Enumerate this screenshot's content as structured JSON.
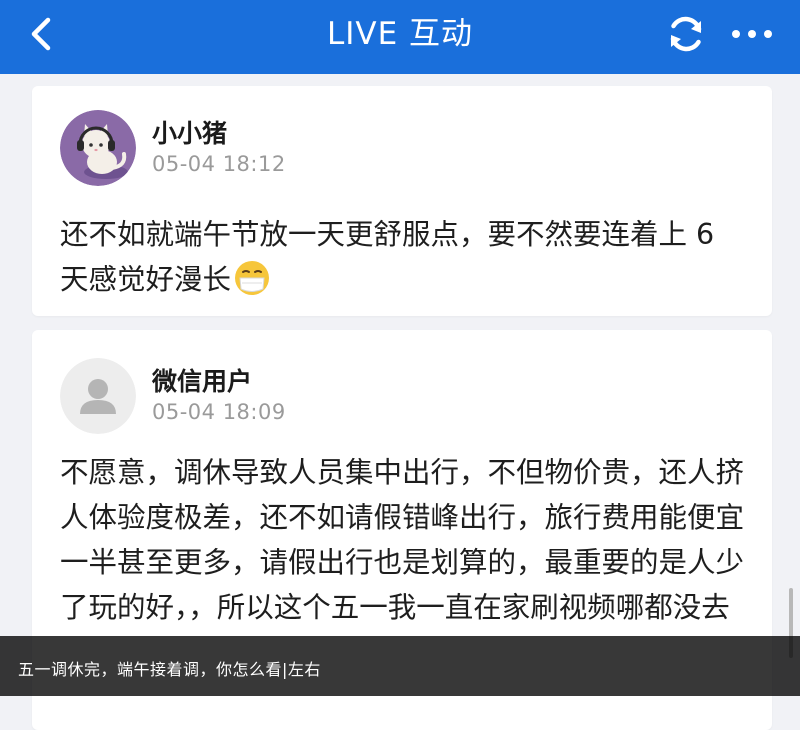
{
  "header": {
    "title": "LIVE 互动",
    "back_icon": "chevron-left-icon",
    "refresh_icon": "refresh-icon",
    "more_icon": "more-dots-icon",
    "background_color": "#1a6fdb"
  },
  "comments": [
    {
      "username": "小小猪",
      "time": "05-04 18:12",
      "text": "还不如就端午节放一天更舒服点，要不然要连着上 6 天感觉好漫长",
      "emoji": "mask-face-emoji",
      "avatar": "cat-headphones-avatar"
    },
    {
      "username": "微信用户",
      "time": "05-04 18:09",
      "text": "不愿意，调休导致人员集中出行，不但物价贵，还人挤人体验度极差，还不如请假错峰出行，旅行费用能便宜一半甚至更多，请假出行也是划算的，最重要的是人少了玩的好，，所以这个五一我一直在家刷视频哪都没去",
      "avatar": "default-user-avatar"
    }
  ],
  "caption": {
    "text": "五一调休完，端午接着调，你怎么看|左右"
  }
}
